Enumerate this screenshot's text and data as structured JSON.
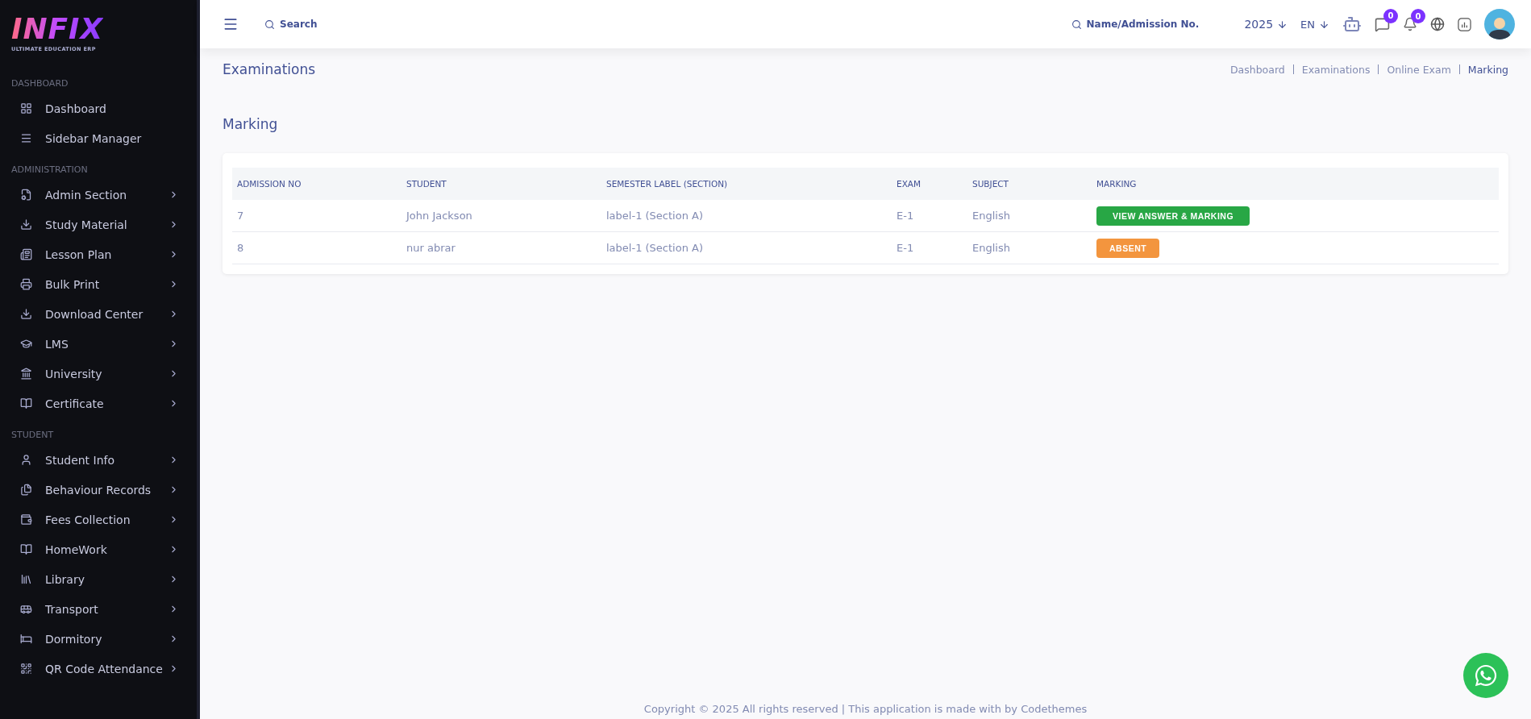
{
  "logo": {
    "wordmark": "INFIX",
    "tagline": "ULTIMATE EDUCATION ERP"
  },
  "sidebar": {
    "sections": [
      {
        "heading": "DASHBOARD",
        "items": [
          {
            "label": "Dashboard",
            "expandable": false
          },
          {
            "label": "Sidebar Manager",
            "expandable": false
          }
        ]
      },
      {
        "heading": "ADMINISTRATION",
        "items": [
          {
            "label": "Admin Section",
            "expandable": true
          },
          {
            "label": "Study Material",
            "expandable": true
          },
          {
            "label": "Lesson Plan",
            "expandable": true
          },
          {
            "label": "Bulk Print",
            "expandable": true
          },
          {
            "label": "Download Center",
            "expandable": true
          },
          {
            "label": "LMS",
            "expandable": true
          },
          {
            "label": "University",
            "expandable": true
          },
          {
            "label": "Certificate",
            "expandable": true
          }
        ]
      },
      {
        "heading": "STUDENT",
        "items": [
          {
            "label": "Student Info",
            "expandable": true
          },
          {
            "label": "Behaviour Records",
            "expandable": true
          },
          {
            "label": "Fees Collection",
            "expandable": true
          },
          {
            "label": "HomeWork",
            "expandable": true
          },
          {
            "label": "Library",
            "expandable": true
          },
          {
            "label": "Transport",
            "expandable": true
          },
          {
            "label": "Dormitory",
            "expandable": true
          },
          {
            "label": "QR Code Attendance",
            "expandable": true
          }
        ]
      }
    ]
  },
  "header": {
    "search": {
      "placeholder": "Search"
    },
    "student_search": {
      "placeholder": "Name/Admission No."
    },
    "year": "2025",
    "language": "EN",
    "messages_badge": "0",
    "notifications_badge": "0"
  },
  "page": {
    "title": "Examinations",
    "breadcrumbs": [
      {
        "label": "Dashboard",
        "active": false
      },
      {
        "label": "Examinations",
        "active": false
      },
      {
        "label": "Online Exam",
        "active": false
      },
      {
        "label": "Marking",
        "active": true
      }
    ],
    "section_title": "Marking"
  },
  "table": {
    "columns": [
      "ADMISSION NO",
      "STUDENT",
      "SEMESTER LABEL (SECTION)",
      "EXAM",
      "SUBJECT",
      "MARKING"
    ],
    "rows": [
      {
        "admission_no": "7",
        "student": "John Jackson",
        "semester_label": "label-1 (Section A)",
        "exam": "E-1",
        "subject": "English",
        "marking": {
          "kind": "view",
          "label": "VIEW ANSWER & MARKING"
        }
      },
      {
        "admission_no": "8",
        "student": "nur abrar",
        "semester_label": "label-1 (Section A)",
        "exam": "E-1",
        "subject": "English",
        "marking": {
          "kind": "absent",
          "label": "ABSENT"
        }
      }
    ]
  },
  "footer": "Copyright © 2025 All rights reserved | This application is made with by Codethemes"
}
